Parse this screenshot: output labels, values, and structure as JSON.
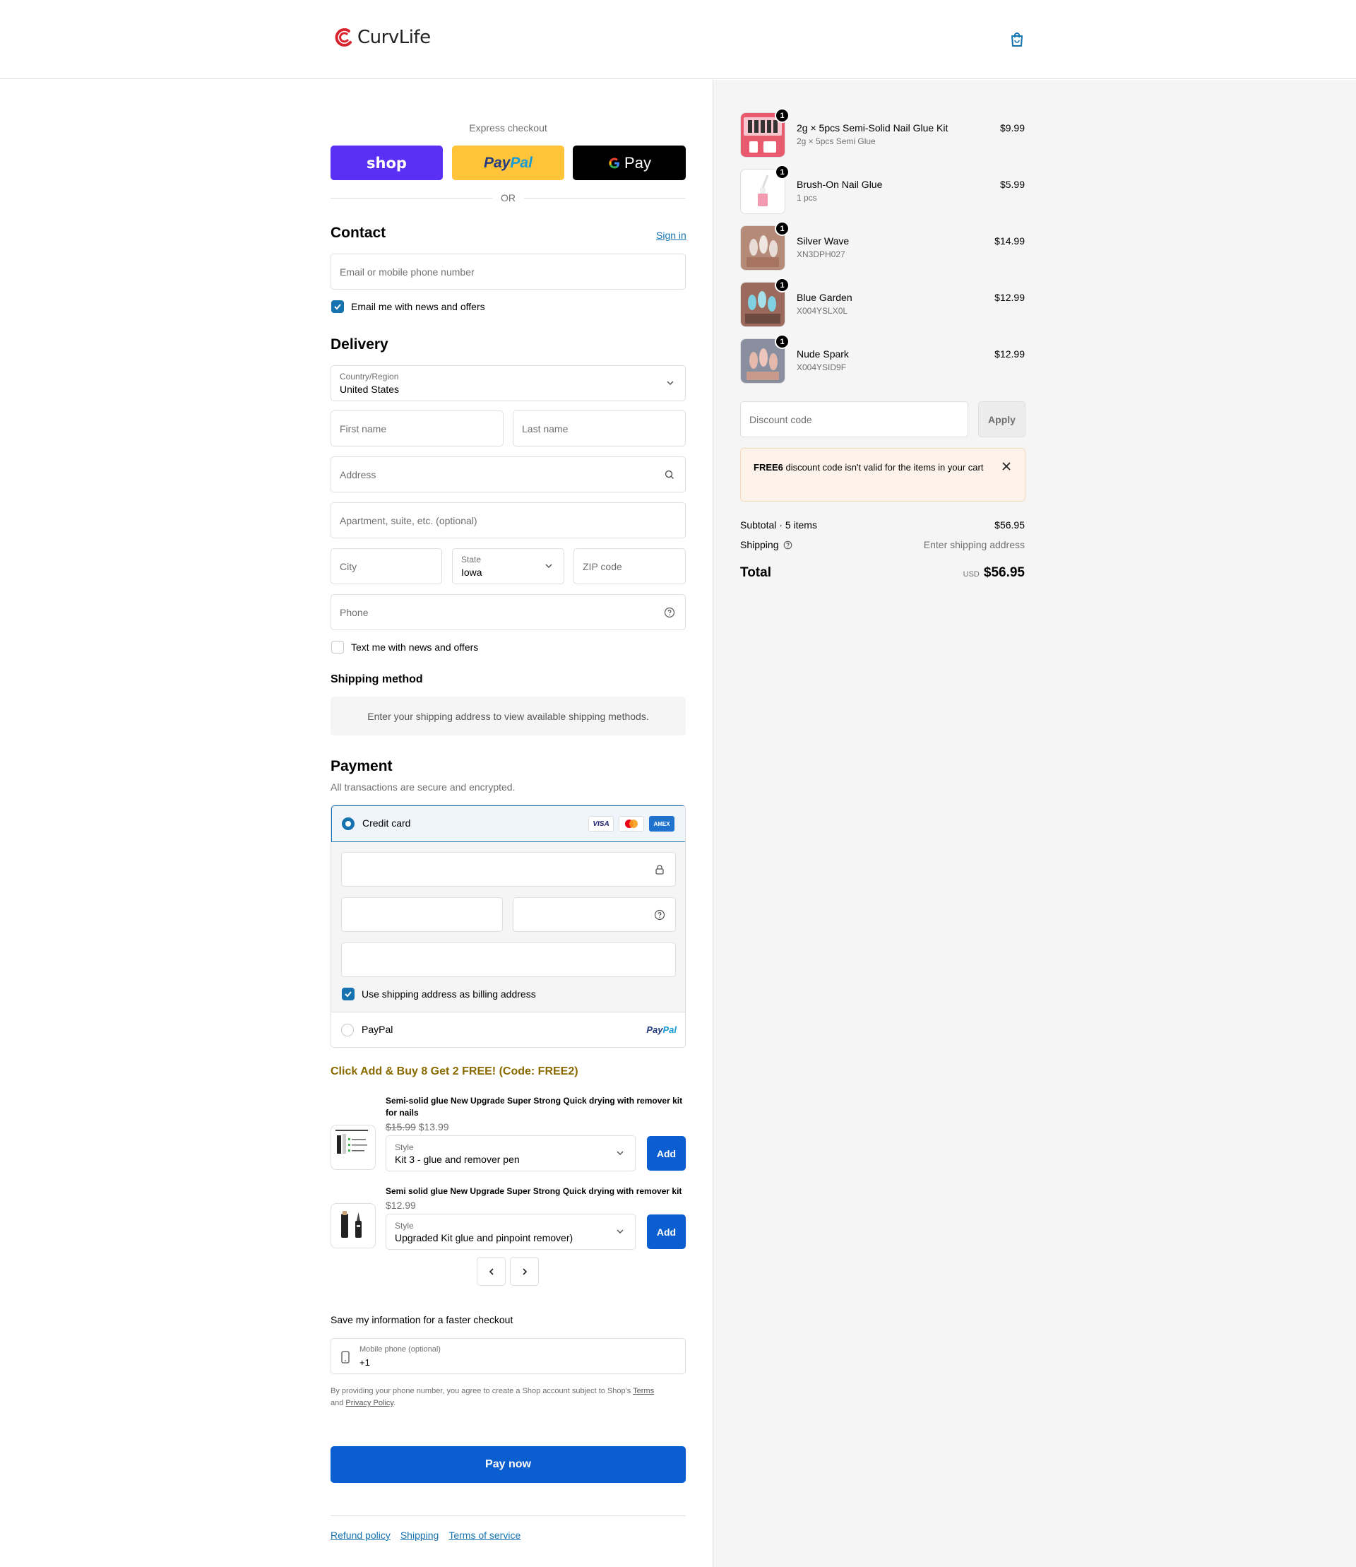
{
  "header": {
    "brand": "CurvLife"
  },
  "express": {
    "label": "Express checkout",
    "shop": "shop",
    "paypal_a": "Pay",
    "paypal_b": "Pal",
    "gpay": "Pay",
    "or": "OR"
  },
  "contact": {
    "title": "Contact",
    "sign_in": "Sign in",
    "email_placeholder": "Email or mobile phone number",
    "newsletter": "Email me with news and offers"
  },
  "delivery": {
    "title": "Delivery",
    "country_label": "Country/Region",
    "country_value": "United States",
    "first_name": "First name",
    "last_name": "Last name",
    "address": "Address",
    "apartment": "Apartment, suite, etc. (optional)",
    "city": "City",
    "state_label": "State",
    "state_value": "Iowa",
    "zip": "ZIP code",
    "phone": "Phone",
    "text_offers": "Text me with news and offers"
  },
  "shipping_method": {
    "title": "Shipping method",
    "message": "Enter your shipping address to view available shipping methods."
  },
  "payment": {
    "title": "Payment",
    "subtitle": "All transactions are secure and encrypted.",
    "credit_card": "Credit card",
    "visa": "VISA",
    "amex": "AMEX",
    "billing": "Use shipping address as billing address",
    "paypal": "PayPal",
    "paypal_logo_a": "Pay",
    "paypal_logo_b": "Pal"
  },
  "upsell": {
    "title": "Click Add & Buy 8 Get 2 FREE! (Code: FREE2)",
    "products": [
      {
        "title": "Semi-solid glue New Upgrade Super Strong Quick drying with remover kit for nails",
        "old_price": "$15.99",
        "price": "$13.99",
        "style_label": "Style",
        "style_value": "Kit 3 - glue and remover pen",
        "add": "Add"
      },
      {
        "title": "Semi solid glue New Upgrade Super Strong Quick drying with remover kit",
        "price": "$12.99",
        "style_label": "Style",
        "style_value": "Upgraded Kit glue and pinpoint remover)",
        "add": "Add"
      }
    ]
  },
  "save_info": {
    "title": "Save my information for a faster checkout",
    "phone_label": "Mobile phone (optional)",
    "phone_value": "+1",
    "legal_a": "By providing your phone number, you agree to create a Shop account subject to Shop's",
    "terms": "Terms",
    "legal_b": "and",
    "privacy": "Privacy Policy",
    "legal_c": "."
  },
  "pay_now": "Pay now",
  "footer": {
    "refund": "Refund policy",
    "shipping": "Shipping",
    "terms": "Terms of service"
  },
  "summary": {
    "items": [
      {
        "qty": "1",
        "name": "2g × 5pcs Semi-Solid Nail Glue Kit",
        "sub": "2g × 5pcs Semi Glue",
        "price": "$9.99"
      },
      {
        "qty": "1",
        "name": "Brush-On Nail Glue",
        "sub": "1 pcs",
        "price": "$5.99"
      },
      {
        "qty": "1",
        "name": "Silver Wave",
        "sub": "XN3DPH027",
        "price": "$14.99"
      },
      {
        "qty": "1",
        "name": "Blue Garden",
        "sub": "X004YSLX0L",
        "price": "$12.99"
      },
      {
        "qty": "1",
        "name": "Nude Spark",
        "sub": "X004YSID9F",
        "price": "$12.99"
      }
    ],
    "discount_placeholder": "Discount code",
    "apply": "Apply",
    "alert_code": "FREE6",
    "alert_text": " discount code isn't valid for the items in your cart",
    "subtotal_label": "Subtotal · 5 items",
    "subtotal_value": "$56.95",
    "shipping_label": "Shipping",
    "shipping_value": "Enter shipping address",
    "total_label": "Total",
    "currency": "USD",
    "total_value": "$56.95"
  },
  "colors": {
    "accent": "#1773b0",
    "button": "#0a5ecf",
    "shop": "#5a31f4",
    "paypal": "#ffc439",
    "promo": "#8a6a00"
  }
}
